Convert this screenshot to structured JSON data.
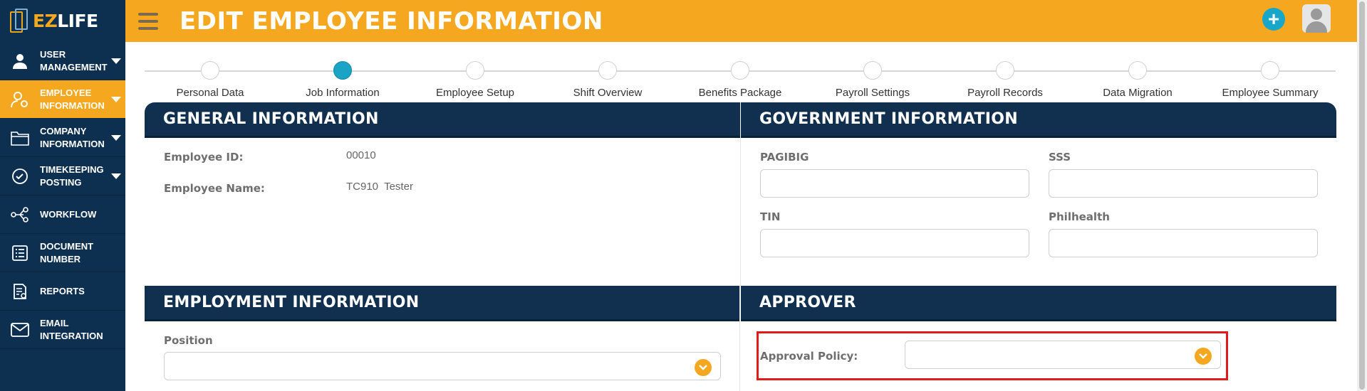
{
  "sidebar": {
    "logo_ez": "EZ",
    "logo_life": "LIFE",
    "items": [
      {
        "label_1": "USER",
        "label_2": "MANAGEMENT"
      },
      {
        "label_1": "EMPLOYEE",
        "label_2": "INFORMATION"
      },
      {
        "label_1": "COMPANY",
        "label_2": "INFORMATION"
      },
      {
        "label_1": "TIMEKEEPING",
        "label_2": "POSTING"
      },
      {
        "label_1": "WORKFLOW",
        "label_2": ""
      },
      {
        "label_1": "DOCUMENT",
        "label_2": "NUMBER"
      },
      {
        "label_1": "REPORTS",
        "label_2": ""
      },
      {
        "label_1": "EMAIL",
        "label_2": "INTEGRATION"
      }
    ]
  },
  "header": {
    "title": "EDIT EMPLOYEE INFORMATION",
    "add_symbol": "+"
  },
  "stepper": {
    "steps": [
      "Personal Data",
      "Job Information",
      "Employee Setup",
      "Shift Overview",
      "Benefits Package",
      "Payroll Settings",
      "Payroll Records",
      "Data Migration",
      "Employee Summary"
    ],
    "active_index": 1
  },
  "general": {
    "title": "GENERAL INFORMATION",
    "employee_id_label": "Employee ID:",
    "employee_id_value": "00010",
    "employee_name_label": "Employee Name:",
    "employee_name_value": "TC910  Tester"
  },
  "government": {
    "title": "GOVERNMENT INFORMATION",
    "pagibig_label": "PAGIBIG",
    "sss_label": "SSS",
    "tin_label": "TIN",
    "philhealth_label": "Philhealth"
  },
  "employment": {
    "title": "EMPLOYMENT INFORMATION",
    "position_label": "Position"
  },
  "approver": {
    "title": "APPROVER",
    "approval_policy_label": "Approval Policy:"
  },
  "colors": {
    "accent": "#f5a81f",
    "navy": "#11304f",
    "teal": "#1aa3c4",
    "highlight": "#e01b1b"
  }
}
